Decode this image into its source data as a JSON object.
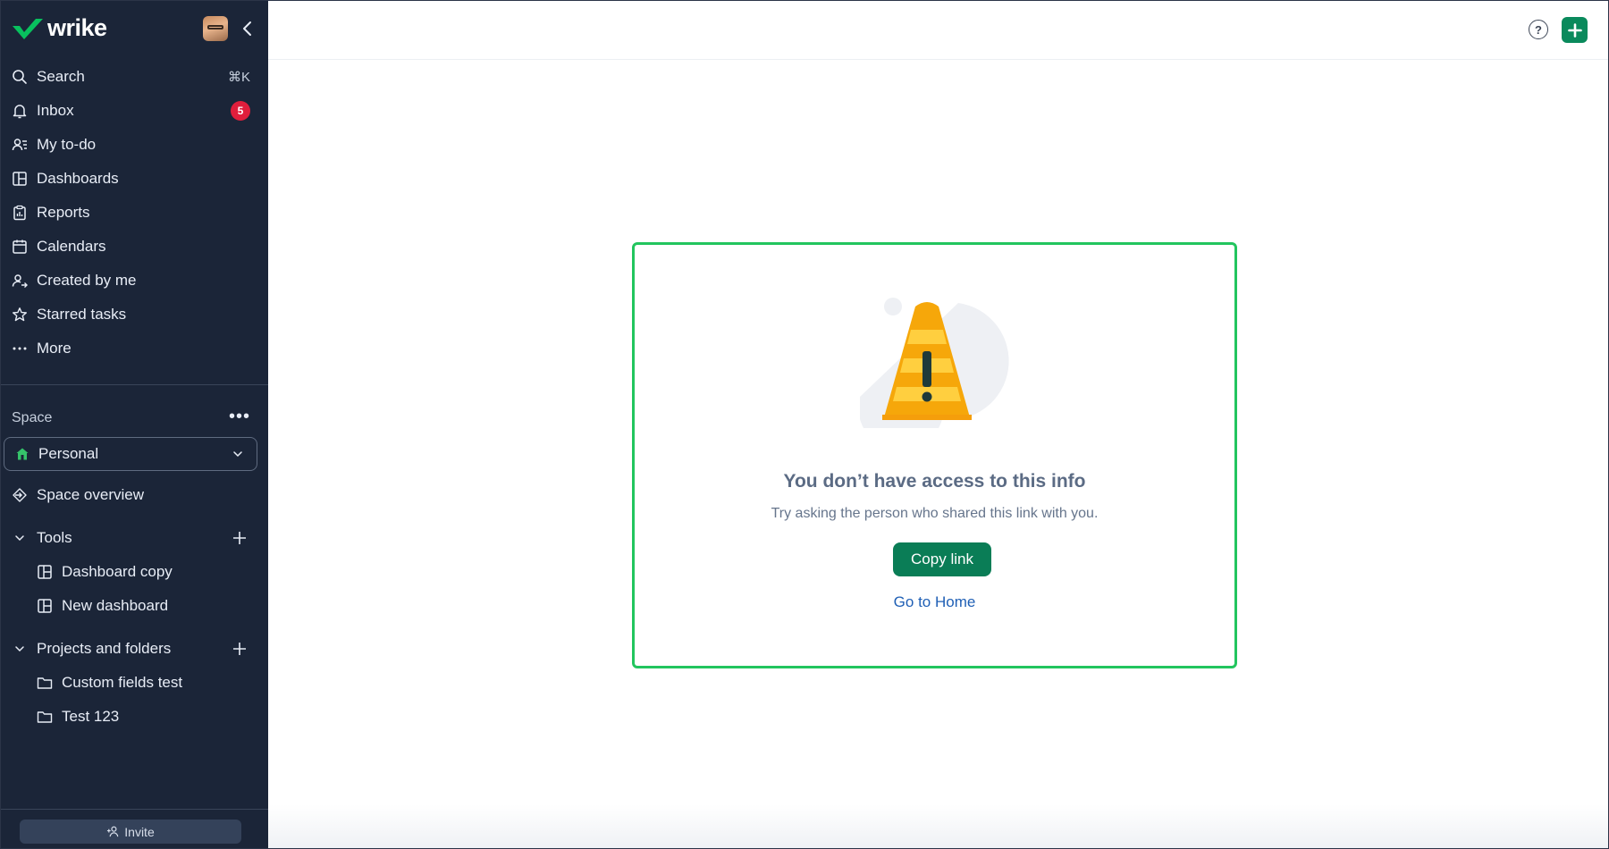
{
  "app": {
    "name": "wrike"
  },
  "sidebar": {
    "nav": [
      {
        "label": "Search",
        "icon": "search-icon",
        "shortcut": "⌘K"
      },
      {
        "label": "Inbox",
        "icon": "bell-icon",
        "badge": "5"
      },
      {
        "label": "My to-do",
        "icon": "user-list-icon"
      },
      {
        "label": "Dashboards",
        "icon": "dashboard-icon"
      },
      {
        "label": "Reports",
        "icon": "report-icon"
      },
      {
        "label": "Calendars",
        "icon": "calendar-icon"
      },
      {
        "label": "Created by me",
        "icon": "user-arrow-icon"
      },
      {
        "label": "Starred tasks",
        "icon": "star-icon"
      },
      {
        "label": "More",
        "icon": "dots-icon"
      }
    ],
    "space": {
      "label": "Space",
      "selected": "Personal",
      "overview": "Space overview"
    },
    "tools": {
      "label": "Tools",
      "items": [
        "Dashboard copy",
        "New dashboard"
      ]
    },
    "projects": {
      "label": "Projects and folders",
      "items": [
        "Custom fields test",
        "Test 123"
      ]
    },
    "invite_label": "Invite"
  },
  "main": {
    "message": {
      "title": "You don’t have access to this info",
      "subtitle": "Try asking the person who shared this link with you.",
      "copy_button": "Copy link",
      "home_link": "Go to Home"
    },
    "help_label": "?"
  },
  "colors": {
    "sidebar_bg": "#1b2538",
    "accent": "#0a8a5c",
    "highlight_border": "#22c55e",
    "badge": "#e01e3c",
    "link": "#1f5fb5"
  }
}
